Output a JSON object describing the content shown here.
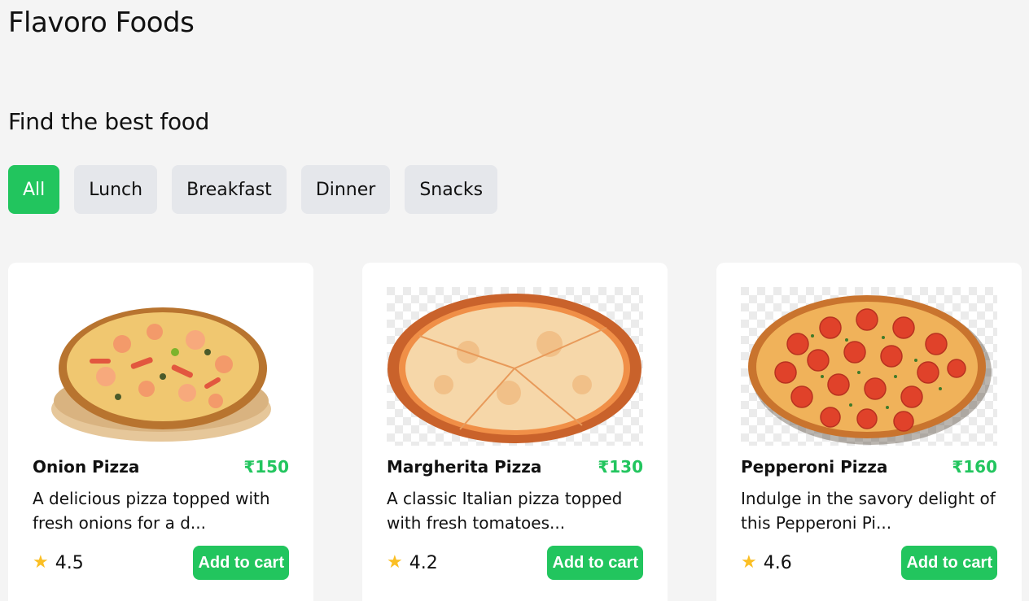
{
  "brand": "Flavoro Foods",
  "heading": "Find the best food",
  "filters": [
    {
      "label": "All",
      "active": true
    },
    {
      "label": "Lunch",
      "active": false
    },
    {
      "label": "Breakfast",
      "active": false
    },
    {
      "label": "Dinner",
      "active": false
    },
    {
      "label": "Snacks",
      "active": false
    }
  ],
  "cards": [
    {
      "name": "Onion Pizza",
      "price": "₹150",
      "description": "A delicious pizza topped with fresh onions for a d...",
      "rating": "4.5",
      "button": "Add to cart",
      "image_icon": "onion-pizza-image"
    },
    {
      "name": "Margherita Pizza",
      "price": "₹130",
      "description": "A classic Italian pizza topped with fresh tomatoes...",
      "rating": "4.2",
      "button": "Add to cart",
      "image_icon": "margherita-pizza-image"
    },
    {
      "name": "Pepperoni Pizza",
      "price": "₹160",
      "description": "Indulge in the savory delight of this Pepperoni Pi...",
      "rating": "4.6",
      "button": "Add to cart",
      "image_icon": "pepperoni-pizza-image"
    }
  ],
  "colors": {
    "accent": "#22c55e",
    "chip_bg": "#e5e7eb",
    "page_bg": "#f4f4f4",
    "star": "#fbbf24"
  }
}
